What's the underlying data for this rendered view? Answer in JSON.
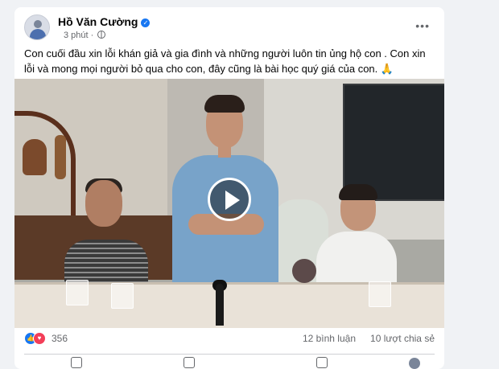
{
  "post": {
    "author": "Hồ Văn Cường",
    "time": "3 phút",
    "time_sep": "·",
    "text": "Con cuối đầu xin lỗi khán giả và gia đình và những người luôn tin ủng hộ con . Con xin lỗi và mong mọi người bỏ qua cho con, đây cũng là bài học quý giá của con. 🙏"
  },
  "icons": {
    "verified": "verified-check-icon",
    "audience": "globe-icon",
    "more": "more-options-icon",
    "play": "play-icon",
    "like_reaction": "like-reaction-icon",
    "love_reaction": "love-reaction-icon"
  },
  "stats": {
    "reactions": "356",
    "comments": "12 bình luận",
    "shares": "10 lượt chia sẻ"
  },
  "colors": {
    "accent": "#1877f2",
    "love": "#f33e58",
    "muted_text": "#65676b"
  }
}
